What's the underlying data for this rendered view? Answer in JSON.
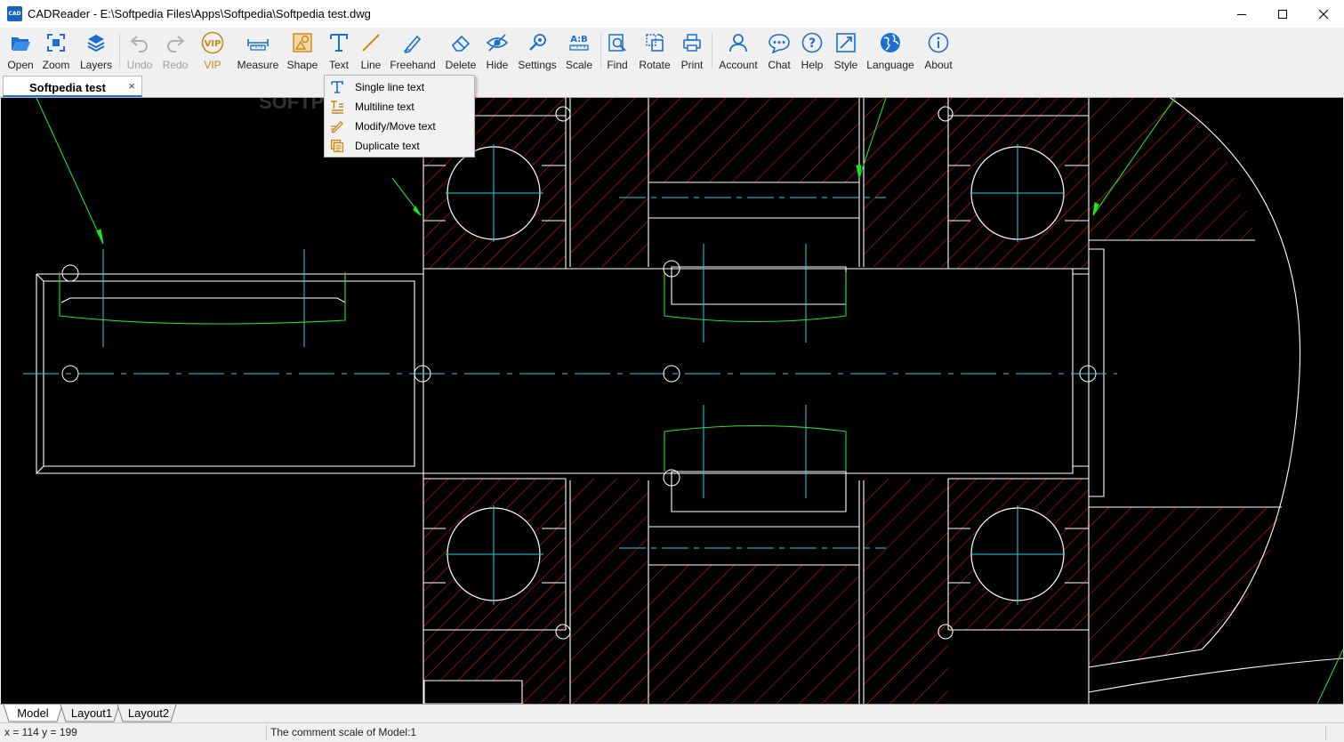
{
  "window": {
    "title": "CADReader - E:\\Softpedia Files\\Apps\\Softpedia\\Softpedia test.dwg",
    "icon_text": "CAD",
    "controls": [
      "minimize-icon",
      "maximize-icon",
      "close-icon"
    ]
  },
  "toolbar": {
    "items": [
      {
        "label": "Open",
        "icon": "folder-open-icon"
      },
      {
        "label": "Zoom",
        "icon": "zoom-extents-icon"
      },
      {
        "label": "Layers",
        "icon": "layers-icon"
      },
      {
        "label": "Undo",
        "icon": "undo-icon",
        "disabled": true
      },
      {
        "label": "Redo",
        "icon": "redo-icon",
        "disabled": true
      },
      {
        "label": "VIP",
        "icon": "vip-badge-icon",
        "badge": "VIP"
      },
      {
        "label": "Measure",
        "icon": "ruler-icon"
      },
      {
        "label": "Shape",
        "icon": "shape-icon"
      },
      {
        "label": "Text",
        "icon": "text-icon"
      },
      {
        "label": "Line",
        "icon": "line-icon"
      },
      {
        "label": "Freehand",
        "icon": "pen-icon"
      },
      {
        "label": "Delete",
        "icon": "eraser-icon"
      },
      {
        "label": "Hide",
        "icon": "eye-hide-icon"
      },
      {
        "label": "Settings",
        "icon": "settings-icon"
      },
      {
        "label": "Scale",
        "icon": "scale-icon",
        "badge": "A:B"
      },
      {
        "label": "Find",
        "icon": "find-icon"
      },
      {
        "label": "Rotate",
        "icon": "rotate-icon"
      },
      {
        "label": "Print",
        "icon": "printer-icon"
      },
      {
        "label": "Account",
        "icon": "account-icon"
      },
      {
        "label": "Chat",
        "icon": "chat-icon"
      },
      {
        "label": "Help",
        "icon": "help-icon"
      },
      {
        "label": "Style",
        "icon": "style-icon"
      },
      {
        "label": "Language",
        "icon": "globe-icon"
      },
      {
        "label": "About",
        "icon": "info-icon"
      }
    ]
  },
  "document_tab": {
    "name": "Softpedia test",
    "close_glyph": "×"
  },
  "text_menu": {
    "items": [
      {
        "label": "Single line text",
        "icon": "single-line-text-icon"
      },
      {
        "label": "Multiline text",
        "icon": "multiline-text-icon"
      },
      {
        "label": "Modify/Move text",
        "icon": "modify-text-icon"
      },
      {
        "label": "Duplicate text",
        "icon": "duplicate-text-icon"
      }
    ]
  },
  "watermark": {
    "text": "SOFTPEDIA"
  },
  "layout_tabs": [
    {
      "label": "Model",
      "active": true
    },
    {
      "label": "Layout1",
      "active": false
    },
    {
      "label": "Layout2",
      "active": false
    }
  ],
  "status": {
    "coords": "x = 114 y = 199",
    "scale_text": "The comment scale of Model:1"
  },
  "colors": {
    "accent": "#1e73d8",
    "drawing_background": "#000000",
    "outline": "#ffffff",
    "hatch": "#ff1a1a",
    "centerline": "#1fd4e0",
    "leader": "#22e022",
    "vip": "#c58a1a"
  }
}
